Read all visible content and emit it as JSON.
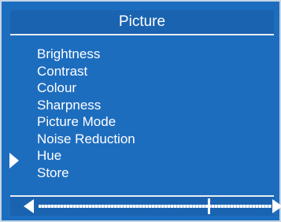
{
  "title": "Picture",
  "menu": {
    "items": [
      {
        "label": "Brightness"
      },
      {
        "label": "Contrast"
      },
      {
        "label": "Colour"
      },
      {
        "label": "Sharpness"
      },
      {
        "label": "Picture Mode"
      },
      {
        "label": "Noise Reduction"
      },
      {
        "label": "Hue"
      },
      {
        "label": "Store"
      }
    ],
    "selected_label": "Hue"
  },
  "slider": {
    "value_fraction": 0.73
  },
  "colors": {
    "background": "#1d6dbf",
    "title_bar": "#1a63b0",
    "text": "#ffffff"
  }
}
